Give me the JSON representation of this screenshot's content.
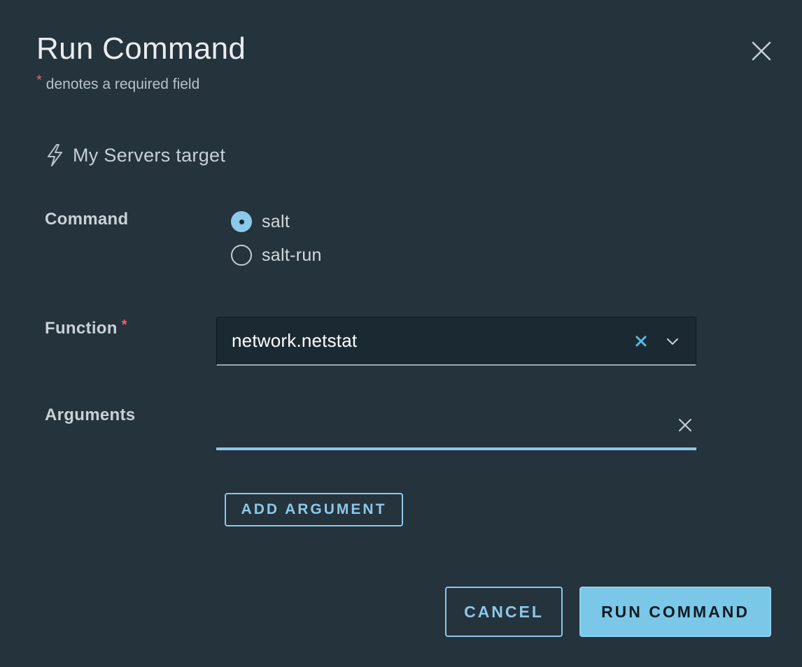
{
  "dialog": {
    "title": "Run Command",
    "required_marker": "*",
    "required_note": "denotes a required field"
  },
  "target": {
    "icon": "lightning-bolt-icon",
    "label": "My Servers target"
  },
  "command": {
    "label": "Command",
    "options": [
      {
        "label": "salt",
        "selected": true
      },
      {
        "label": "salt-run",
        "selected": false
      }
    ]
  },
  "function": {
    "label": "Function",
    "required_marker": "*",
    "value": "network.netstat"
  },
  "arguments": {
    "label": "Arguments",
    "value": ""
  },
  "buttons": {
    "add_argument": "ADD ARGUMENT",
    "cancel": "CANCEL",
    "run": "RUN COMMAND"
  },
  "colors": {
    "background": "#25333d",
    "accent": "#8cc8e8",
    "required": "#f35e61"
  }
}
